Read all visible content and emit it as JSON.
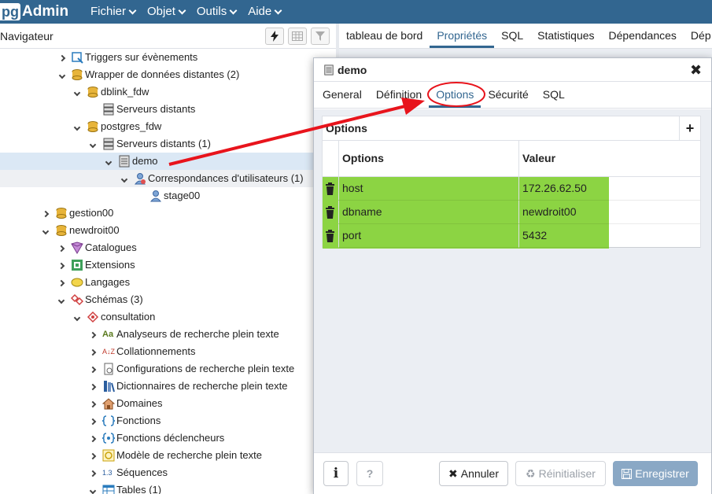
{
  "app": {
    "logo_pg": "pg",
    "logo_admin": "Admin"
  },
  "menu": [
    "Fichier",
    "Objet",
    "Outils",
    "Aide"
  ],
  "navigator": {
    "title": "Navigateur"
  },
  "tree": [
    {
      "label": "Triggers sur évènements",
      "icon": "triggers-icon"
    },
    {
      "label": "Wrapper de données distantes (2)",
      "icon": "fdw-icon"
    },
    {
      "label": "dblink_fdw",
      "icon": "fdw-icon"
    },
    {
      "label": "Serveurs distants",
      "icon": "servers-icon"
    },
    {
      "label": "postgres_fdw",
      "icon": "fdw-icon"
    },
    {
      "label": "Serveurs distants (1)",
      "icon": "servers-icon"
    },
    {
      "label": "demo",
      "icon": "server-icon"
    },
    {
      "label": "Correspondances d'utilisateurs (1)",
      "icon": "user-mappings-icon"
    },
    {
      "label": "stage00",
      "icon": "user-mapping-icon"
    },
    {
      "label": "gestion00",
      "icon": "database-icon"
    },
    {
      "label": "newdroit00",
      "icon": "database-icon"
    },
    {
      "label": "Catalogues",
      "icon": "catalogs-icon"
    },
    {
      "label": "Extensions",
      "icon": "extensions-icon"
    },
    {
      "label": "Langages",
      "icon": "languages-icon"
    },
    {
      "label": "Schémas (3)",
      "icon": "schemas-icon"
    },
    {
      "label": "consultation",
      "icon": "schema-icon"
    },
    {
      "label": "Analyseurs de recherche plein texte",
      "icon": "parsers-icon",
      "glyph": "Aa"
    },
    {
      "label": "Collationnements",
      "icon": "collations-icon",
      "glyph": "A↓Z"
    },
    {
      "label": "Configurations de recherche plein texte",
      "icon": "fts-config-icon"
    },
    {
      "label": "Dictionnaires de recherche plein texte",
      "icon": "fts-dict-icon"
    },
    {
      "label": "Domaines",
      "icon": "domains-icon"
    },
    {
      "label": "Fonctions",
      "icon": "functions-icon"
    },
    {
      "label": "Fonctions déclencheurs",
      "icon": "trigger-functions-icon"
    },
    {
      "label": "Modèle de recherche plein texte",
      "icon": "fts-template-icon"
    },
    {
      "label": "Séquences",
      "icon": "sequences-icon",
      "glyph": "1.3"
    },
    {
      "label": "Tables (1)",
      "icon": "tables-icon"
    }
  ],
  "tabs": [
    "tableau de bord",
    "Propriétés",
    "SQL",
    "Statistiques",
    "Dépendances",
    "Dép"
  ],
  "dialog": {
    "title": "demo",
    "tabs": [
      "General",
      "Définition",
      "Options",
      "Sécurité",
      "SQL"
    ],
    "options": {
      "caption": "Options",
      "add_label": "+",
      "col_name": "Options",
      "col_value": "Valeur",
      "rows": [
        {
          "name": "host",
          "value": "172.26.62.50"
        },
        {
          "name": "dbname",
          "value": "newdroit00"
        },
        {
          "name": "port",
          "value": "5432"
        }
      ]
    },
    "footer": {
      "info_label": "i",
      "help_label": "?",
      "cancel_label": "Annuler",
      "reset_label": "Réinitialiser",
      "save_label": "Enregistrer"
    }
  },
  "colors": {
    "topbar": "#326690",
    "accent": "#326690",
    "highlight": "#8cd443",
    "annotation": "#e8141c"
  }
}
